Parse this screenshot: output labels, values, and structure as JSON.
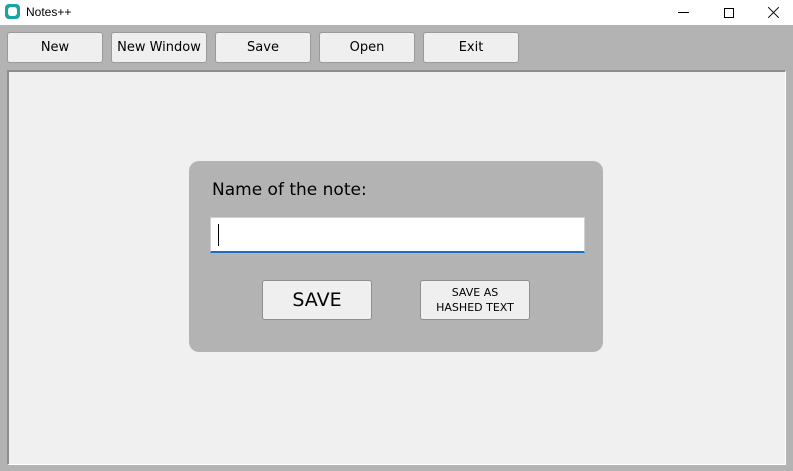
{
  "window": {
    "title": "Notes++",
    "icon": "notes-app-icon",
    "controls": [
      "minimize",
      "maximize",
      "close"
    ]
  },
  "toolbar": {
    "new_label": "New",
    "new_window_label": "New Window",
    "save_label": "Save",
    "open_label": "Open",
    "exit_label": "Exit"
  },
  "dialog": {
    "label": "Name of the note:",
    "input_value": "",
    "save_label": "SAVE",
    "save_hashed_line1": "SAVE AS",
    "save_hashed_line2": "HASHED TEXT"
  },
  "colors": {
    "background": "#b3b3b3",
    "editor": "#f0f0f0",
    "input_focus_underline": "#1a6fc0",
    "app_icon": "#1aa3a3"
  }
}
